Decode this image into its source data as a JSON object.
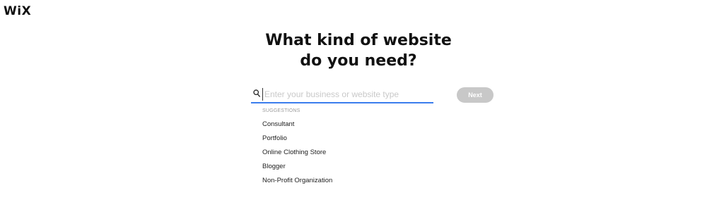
{
  "logo": {
    "text": "WiX"
  },
  "heading": {
    "line1": "What kind of website",
    "line2": "do you need?"
  },
  "search": {
    "value": "",
    "placeholder": "Enter your business or website type",
    "icon": "search-icon"
  },
  "next_button": {
    "label": "Next"
  },
  "suggestions": {
    "label": "SUGGESTIONS",
    "items": [
      "Consultant",
      "Portfolio",
      "Online Clothing Store",
      "Blogger",
      "Non-Profit Organization"
    ]
  },
  "colors": {
    "accent": "#3b7ded",
    "button_disabled": "#c8c8c8",
    "placeholder": "#c9c9c9"
  }
}
